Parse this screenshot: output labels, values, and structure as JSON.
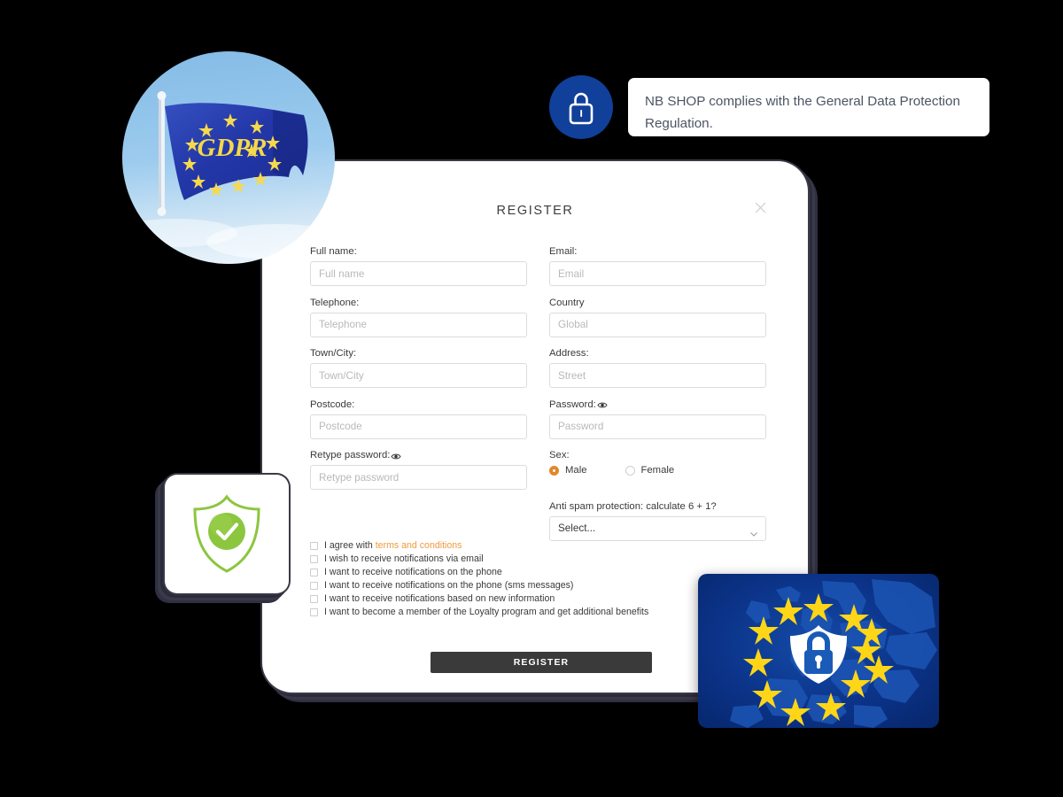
{
  "background_color": "#000000",
  "tooltip": {
    "icon": "lock-icon",
    "text": "NB SHOP complies with the General Data Protection Regulation.",
    "icon_bg_color": "#10409a",
    "text_color": "#4c5564"
  },
  "gdpr_photo": {
    "alt": "eu-flag-photo",
    "flag_text": "GDPR",
    "star_count": 12,
    "flag_color": "#2a3fa8",
    "star_color": "#f4d94a",
    "sky_color": "#8dc2e8"
  },
  "shield_badge": {
    "icon": "shield-check-icon",
    "shield_color": "#8cc63f",
    "check_color": "#ffffff"
  },
  "eu_card": {
    "icon": "shield-lock-icon",
    "star_count": 12,
    "star_color": "#ffd617",
    "card_color": "#0b3388",
    "shield_color": "#ffffff",
    "lock_color": "#1a5bb8"
  },
  "modal": {
    "title": "REGISTER",
    "close_icon": "close-icon",
    "accent_color": "#e0882b",
    "link_color": "#ef9a3d",
    "submit_bg_color": "#3a3a3a"
  },
  "form": {
    "rows": [
      [
        {
          "label": "Full name:",
          "placeholder": "Full name",
          "value": "",
          "name": "full-name"
        },
        {
          "label": "Email:",
          "placeholder": "Email",
          "value": "",
          "name": "email"
        }
      ],
      [
        {
          "label": "Telephone:",
          "placeholder": "Telephone",
          "value": "",
          "name": "telephone"
        },
        {
          "label": "Country",
          "placeholder": "Global",
          "value": "",
          "name": "country"
        }
      ],
      [
        {
          "label": "Town/City:",
          "placeholder": "Town/City",
          "value": "",
          "name": "town-city"
        },
        {
          "label": "Address:",
          "placeholder": "Street",
          "value": "",
          "name": "address"
        }
      ],
      [
        {
          "label": "Postcode:",
          "placeholder": "Postcode",
          "value": "",
          "name": "postcode"
        },
        {
          "label": "Password:",
          "placeholder": "Password",
          "value": "",
          "name": "password",
          "eye": true
        }
      ]
    ],
    "retype": {
      "label": "Retype password:",
      "placeholder": "Retype password",
      "value": "",
      "eye": true
    },
    "sex": {
      "label": "Sex:",
      "options": [
        {
          "label": "Male",
          "selected": true
        },
        {
          "label": "Female",
          "selected": false
        }
      ]
    },
    "antispam": {
      "label": "Anti spam protection: calculate 6 + 1?",
      "selected_option": "Select...",
      "chevron_icon": "chevron-down-icon"
    },
    "checkboxes": [
      {
        "text_before": "I agree with ",
        "link": "terms and conditions",
        "checked": false
      },
      {
        "text_before": "I wish to receive notifications via email",
        "link": "",
        "checked": false
      },
      {
        "text_before": "I want to receive notifications on the phone",
        "link": "",
        "checked": false
      },
      {
        "text_before": "I want to receive notifications on the phone (sms messages)",
        "link": "",
        "checked": false
      },
      {
        "text_before": "I want to receive notifications based on new information",
        "link": "",
        "checked": false
      },
      {
        "text_before": "I want to become a member of the Loyalty program and get additional benefits",
        "link": "",
        "checked": false
      }
    ],
    "submit_label": "REGISTER"
  }
}
